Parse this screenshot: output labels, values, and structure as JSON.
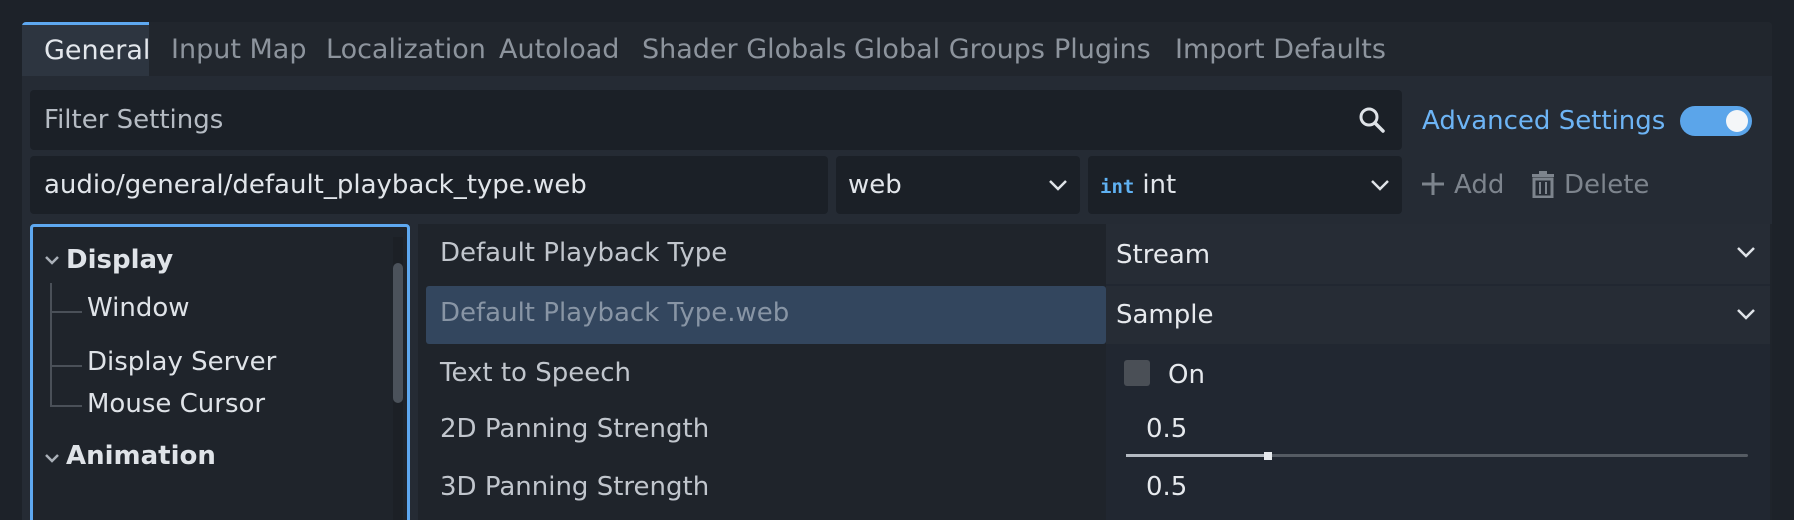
{
  "tabs": [
    "General",
    "Input Map",
    "Localization",
    "Autoload",
    "Shader Globals",
    "Global Groups",
    "Plugins",
    "Import Defaults"
  ],
  "active_tab": "General",
  "filter": {
    "placeholder": "Filter Settings",
    "icon": "search-icon"
  },
  "advanced_settings": {
    "label": "Advanced Settings",
    "enabled": true
  },
  "property_path": "audio/general/default_playback_type.web",
  "feature_dropdown": "web",
  "type_dropdown": {
    "badge": "int",
    "label": "int"
  },
  "add_button": "Add",
  "delete_button": "Delete",
  "tree": {
    "display": "Display",
    "window": "Window",
    "display_server": "Display Server",
    "mouse_cursor": "Mouse Cursor",
    "animation": "Animation"
  },
  "properties": {
    "playback_type": {
      "name": "Default Playback Type",
      "value": "Stream"
    },
    "playback_type_web": {
      "name": "Default Playback Type.web",
      "value": "Sample"
    },
    "text_to_speech": {
      "name": "Text to Speech",
      "value": "On",
      "checked": false
    },
    "panning_2d": {
      "name": "2D Panning Strength",
      "value": "0.5"
    },
    "panning_3d": {
      "name": "3D Panning Strength",
      "value": "0.5"
    }
  },
  "colors": {
    "accent": "#5ea8f0",
    "selected_row": "#33465e",
    "background": "#1d2229"
  }
}
